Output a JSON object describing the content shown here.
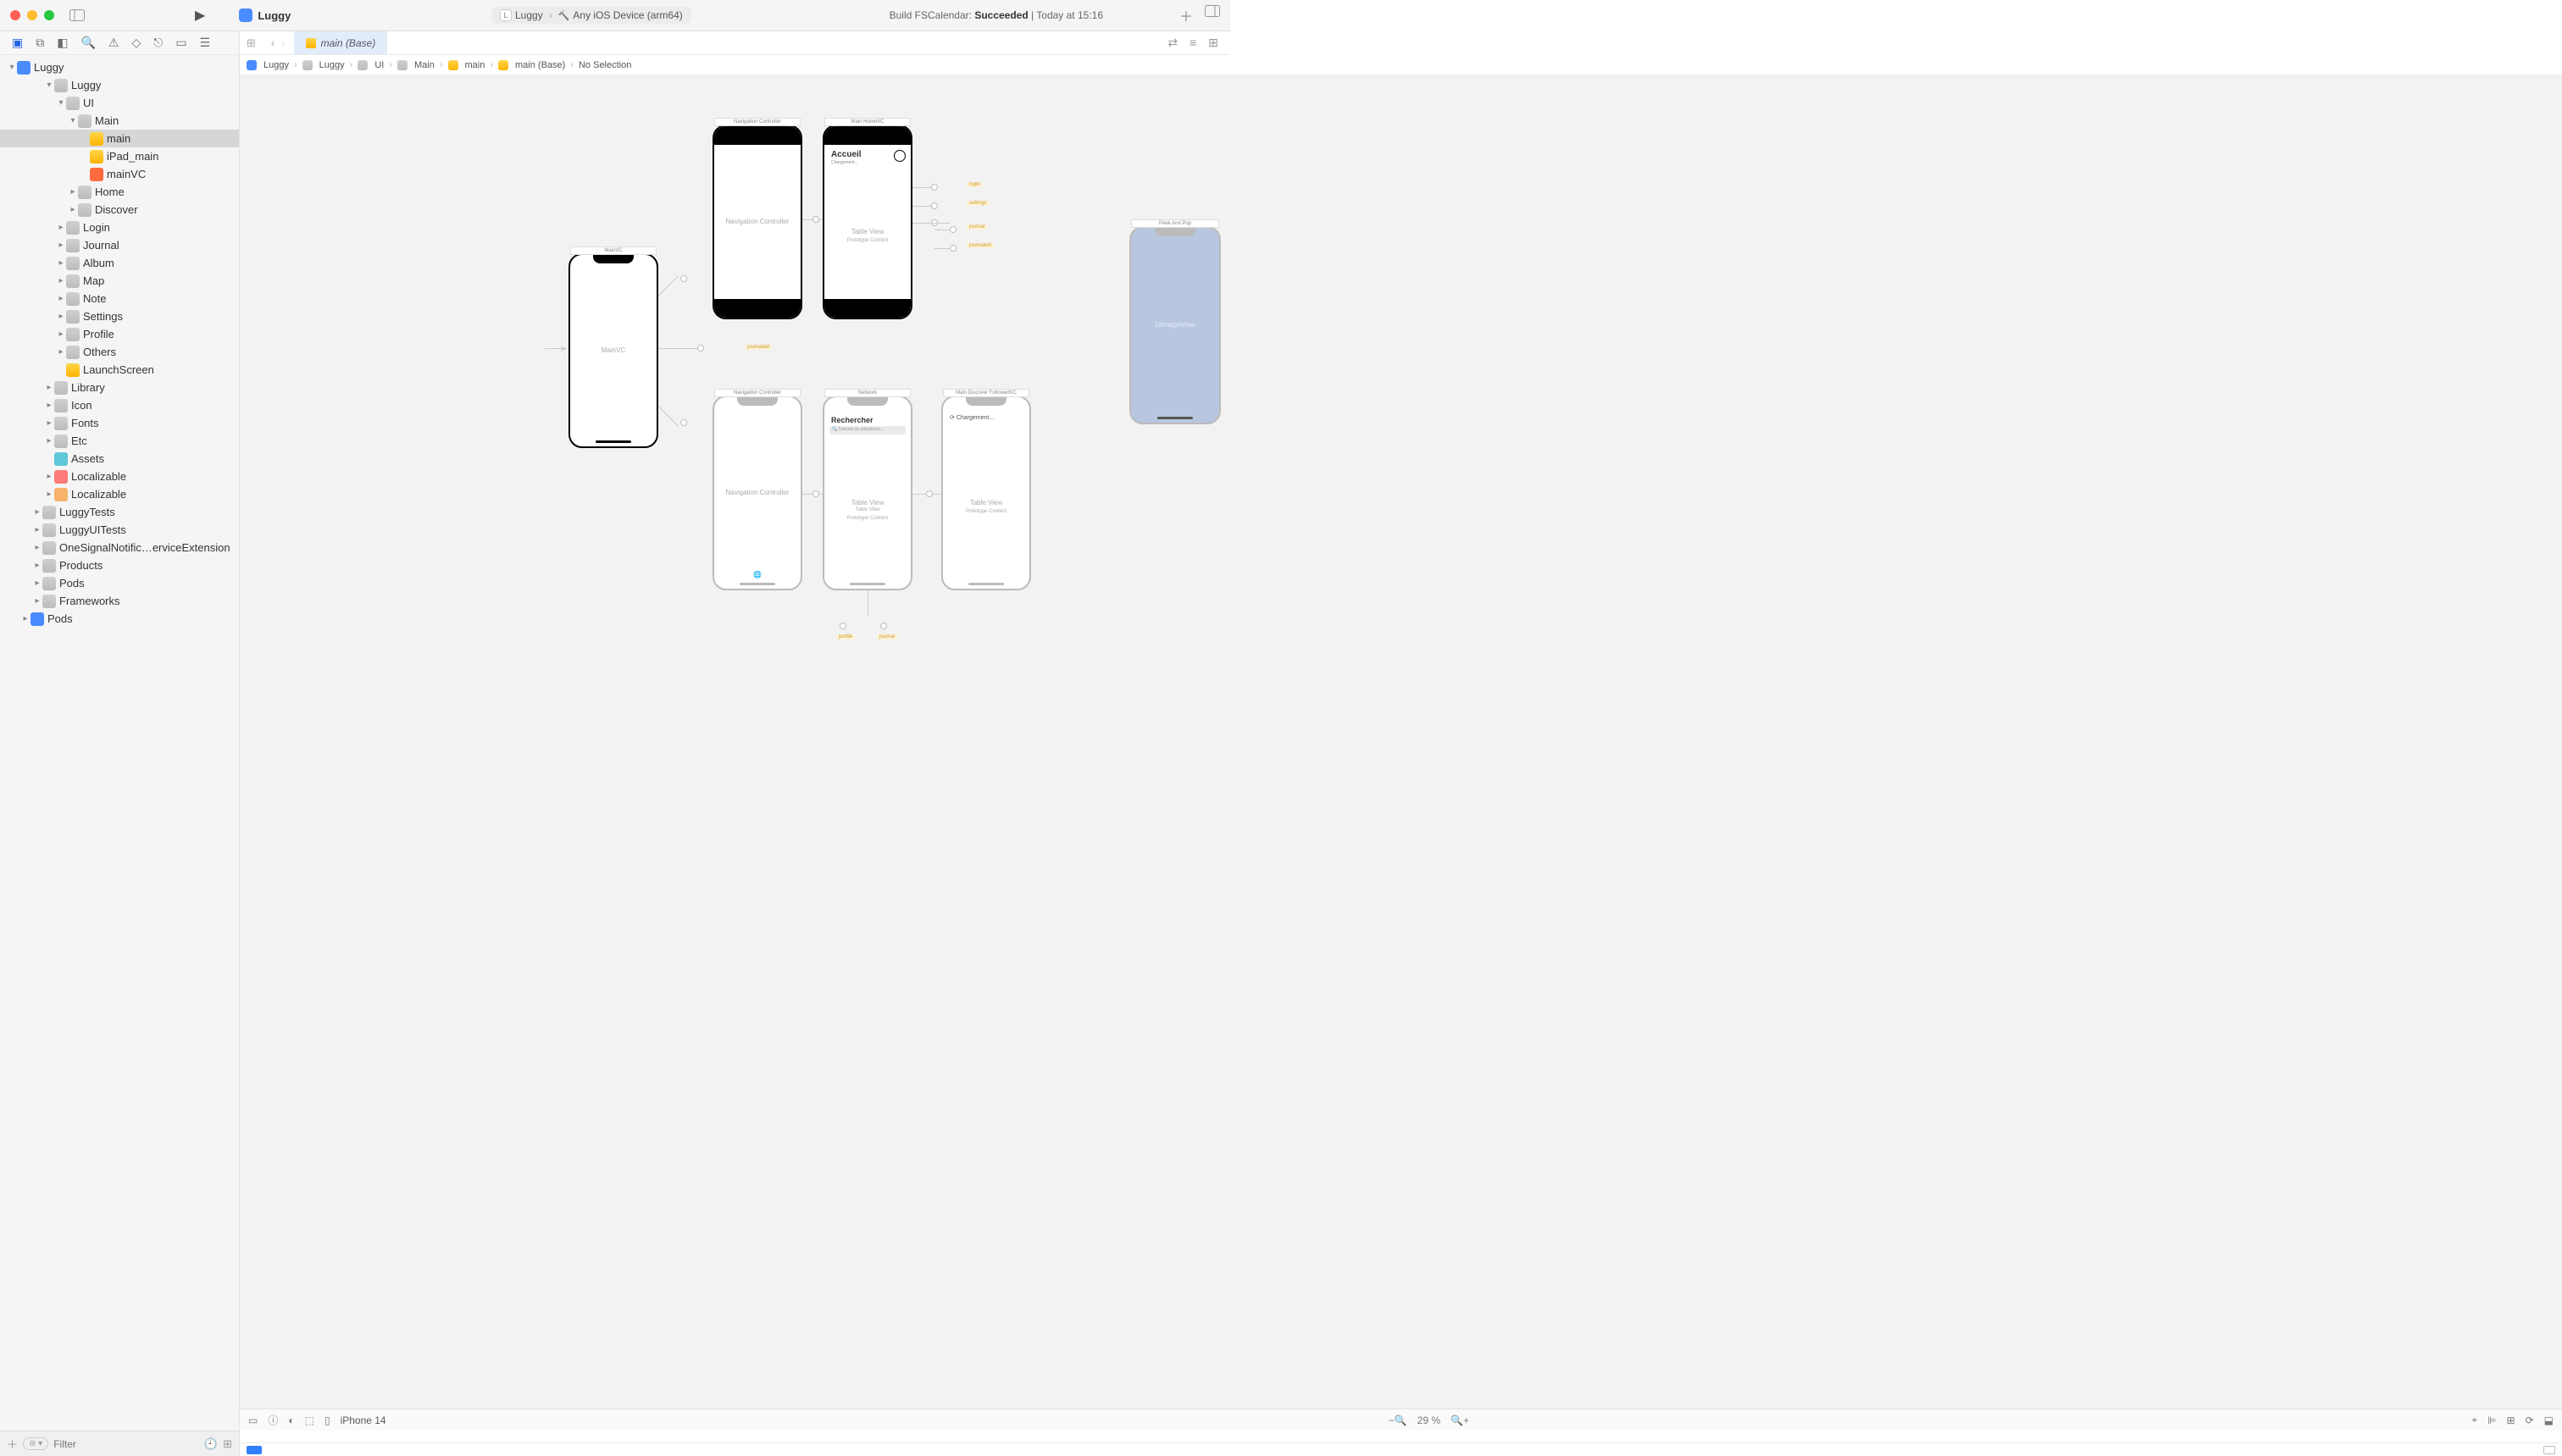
{
  "window": {
    "project": "Luggy"
  },
  "scheme": {
    "name": "Luggy",
    "destination": "Any iOS Device (arm64)"
  },
  "build_status": {
    "prefix": "Build FSCalendar: ",
    "result": "Succeeded",
    "time": "Today at 15:16"
  },
  "tabs": {
    "open": "main (Base)"
  },
  "breadcrumbs": [
    "Luggy",
    "Luggy",
    "UI",
    "Main",
    "main",
    "main (Base)",
    "No Selection"
  ],
  "navigator": {
    "root": "Luggy",
    "tree": [
      {
        "l": "Luggy",
        "d": 1,
        "t": "folder",
        "open": true
      },
      {
        "l": "UI",
        "d": 2,
        "t": "folder",
        "open": true
      },
      {
        "l": "Main",
        "d": 3,
        "t": "folder",
        "open": true
      },
      {
        "l": "main",
        "d": 4,
        "t": "story",
        "sel": true
      },
      {
        "l": "iPad_main",
        "d": 4,
        "t": "story"
      },
      {
        "l": "mainVC",
        "d": 4,
        "t": "swift"
      },
      {
        "l": "Home",
        "d": 3,
        "t": "folder",
        "closed": true
      },
      {
        "l": "Discover",
        "d": 3,
        "t": "folder",
        "closed": true
      },
      {
        "l": "Login",
        "d": 2,
        "t": "folder",
        "closed": true
      },
      {
        "l": "Journal",
        "d": 2,
        "t": "folder",
        "closed": true
      },
      {
        "l": "Album",
        "d": 2,
        "t": "folder",
        "closed": true
      },
      {
        "l": "Map",
        "d": 2,
        "t": "folder",
        "closed": true
      },
      {
        "l": "Note",
        "d": 2,
        "t": "folder",
        "closed": true
      },
      {
        "l": "Settings",
        "d": 2,
        "t": "folder",
        "closed": true
      },
      {
        "l": "Profile",
        "d": 2,
        "t": "folder",
        "closed": true
      },
      {
        "l": "Others",
        "d": 2,
        "t": "folder",
        "closed": true
      },
      {
        "l": "LaunchScreen",
        "d": 2,
        "t": "story"
      },
      {
        "l": "Library",
        "d": 1,
        "t": "folder",
        "closed": true
      },
      {
        "l": "Icon",
        "d": 1,
        "t": "folder",
        "closed": true
      },
      {
        "l": "Fonts",
        "d": 1,
        "t": "folder",
        "closed": true
      },
      {
        "l": "Etc",
        "d": 1,
        "t": "folder",
        "closed": true
      },
      {
        "l": "Assets",
        "d": 1,
        "t": "assets"
      },
      {
        "l": "Localizable",
        "d": 1,
        "t": "plist",
        "closed": true
      },
      {
        "l": "Localizable",
        "d": 1,
        "t": "strings",
        "closed": true
      },
      {
        "l": "LuggyTests",
        "d": 0,
        "t": "folder",
        "closed": true
      },
      {
        "l": "LuggyUITests",
        "d": 0,
        "t": "folder",
        "closed": true
      },
      {
        "l": "OneSignalNotific…erviceExtension",
        "d": 0,
        "t": "folder",
        "closed": true
      },
      {
        "l": "Products",
        "d": 0,
        "t": "folder",
        "closed": true
      },
      {
        "l": "Pods",
        "d": 0,
        "t": "folder",
        "closed": true
      },
      {
        "l": "Frameworks",
        "d": 0,
        "t": "folder",
        "closed": true
      },
      {
        "l": "Pods",
        "d": -1,
        "t": "app",
        "closed": true
      }
    ]
  },
  "canvas": {
    "scenes": {
      "mainvc": {
        "title": "MainVC",
        "label": "MainVC"
      },
      "nav1": {
        "title": "Navigation Controller",
        "label": "Navigation Controller"
      },
      "home": {
        "title": "Main HomeVC",
        "heading": "Accueil",
        "sub": "Chargement...",
        "tv": "Table View",
        "tvs": "Prototype Content"
      },
      "nav2": {
        "title": "Navigation Controller",
        "label": "Navigation Controller"
      },
      "discover": {
        "title": "Network",
        "heading": "Rechercher",
        "search": "Carnets ou utilisateurs...",
        "tv": "Table View",
        "tv2": "Table View",
        "tvs": "Prototype Content"
      },
      "followed": {
        "title": "Main Discover FollowedVC",
        "loading": "Chargement...",
        "tv": "Table View",
        "tvs": "Prototype Content"
      },
      "peek": {
        "title": "Peek And Pop",
        "label": "UIImageView"
      }
    },
    "segues": {
      "s_journalold": "journalold",
      "s_login": "login",
      "s_settings": "settings",
      "s_journal": "journal",
      "s_journalold2": "journalold",
      "s_profile": "profile",
      "s_journal2": "journal"
    }
  },
  "editor_bar": {
    "device": "iPhone 14",
    "zoom": "29 %"
  },
  "filter": {
    "placeholder": "Filter"
  }
}
